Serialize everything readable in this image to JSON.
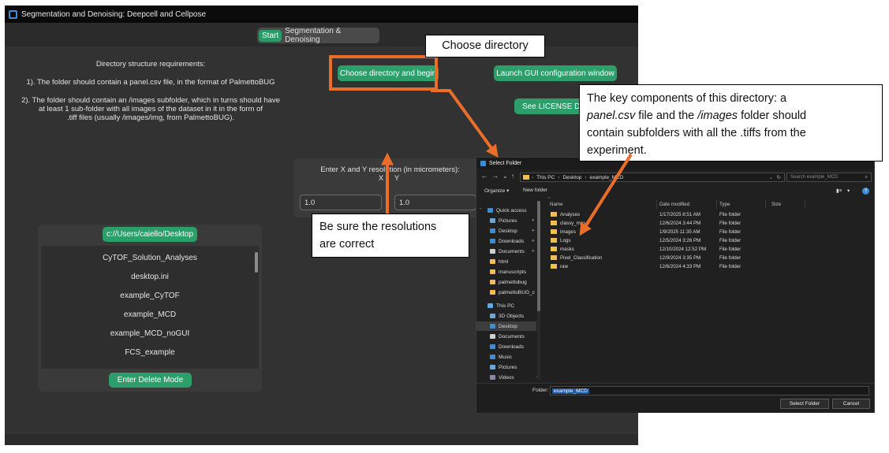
{
  "app": {
    "title": "Segmentation and Denoising: Deepcell and Cellpose",
    "tabs": [
      {
        "label": "Start",
        "active": true
      },
      {
        "label": "Segmentation & Denoising",
        "active": false
      }
    ],
    "requirements": {
      "heading": "Directory structure requirements:",
      "point1": "1). The folder should contain a panel.csv file, in the format of PalmettoBUG",
      "point2_l1": "2). The folder should contain an /images subfolder, which in turns should have",
      "point2_l2": "at least 1 sub-folder with all images of the dataset in it in the form of",
      "point2_l3": ".tiff files (usually /images/img, from PalmettoBUG)."
    },
    "buttons": {
      "choose_dir": "Choose directory and begin",
      "launch_gui": "Launch GUI configuration window",
      "license": "See LICENSE Det",
      "path": "c://Users/caiello/Desktop",
      "delete_mode": "Enter Delete Mode"
    },
    "resolution": {
      "label": "Enter X and Y resolution (in micrometers):",
      "x_label": "X",
      "y_label": "Y",
      "x_value": "1.0",
      "y_value": "1.0"
    },
    "directory_list": [
      "CyTOF_Solution_Analyses",
      "desktop.ini",
      "example_CyTOF",
      "example_MCD",
      "example_MCD_noGUI",
      "FCS_example"
    ]
  },
  "callouts": {
    "choose_dir": "Choose directory",
    "resolution_l1": "Be sure the resolutions",
    "resolution_l2": "are correct",
    "key_l1_a": "The key components of this directory:  a",
    "key_l2_a": "panel.csv",
    "key_l2_b": " file and the ",
    "key_l2_c": "/images",
    "key_l2_d": " folder should",
    "key_l3": "contain subfolders with all the .tiffs from the",
    "key_l4": "experiment."
  },
  "dialog": {
    "title": "Select Folder",
    "nav_glyphs": [
      "←",
      "→",
      "⌄",
      "↑"
    ],
    "breadcrumb": [
      "This PC",
      "Desktop",
      "example_MCD"
    ],
    "addr_sep": "›",
    "addr_controls": [
      "⌄",
      "↻"
    ],
    "search_placeholder": "Search example_MCD",
    "search_glyph": "⌕",
    "organize": "Organize ▾",
    "new_folder": "New folder",
    "view_glyphs": [
      "▮≡",
      "▾",
      "?"
    ],
    "nav_pane": [
      "Quick access",
      "Pictures",
      "Desktop",
      "Downloads",
      "Documents",
      "html",
      "manuscripts",
      "palmettobug",
      "palmettoBUG_c",
      "This PC",
      "3D Objects",
      "Desktop",
      "Documents",
      "Downloads",
      "Music",
      "Pictures",
      "Videos"
    ],
    "nav_expand": "⌄",
    "nav_scroll_end": "⌄",
    "pin_glyph": "✈",
    "columns": [
      "Name",
      "Date modified",
      "Type",
      "Size"
    ],
    "sort_glyph": "^",
    "files": [
      {
        "name": "Analyses",
        "date": "1/17/2025 8:51 AM",
        "type": "File folder"
      },
      {
        "name": "classy_mas",
        "date": "12/6/2024 3:44 PM",
        "type": "File folder"
      },
      {
        "name": "images",
        "date": "1/9/2025 11:35 AM",
        "type": "File folder"
      },
      {
        "name": "Logs",
        "date": "12/5/2024 3:26 PM",
        "type": "File folder"
      },
      {
        "name": "masks",
        "date": "12/10/2024 12:52 PM",
        "type": "File folder"
      },
      {
        "name": "Pixel_Classification",
        "date": "12/9/2024 3:35 PM",
        "type": "File folder"
      },
      {
        "name": "raw",
        "date": "12/6/2024 4:33 PM",
        "type": "File folder"
      }
    ],
    "folder_label": "Folder:",
    "folder_value": "example_MCD",
    "select_button": "Select Folder",
    "cancel_button": "Cancel"
  },
  "colors": {
    "accent_green": "#2c9e6a",
    "callout_orange": "#ea6e2a",
    "folder_yellow": "#f2c04a"
  }
}
